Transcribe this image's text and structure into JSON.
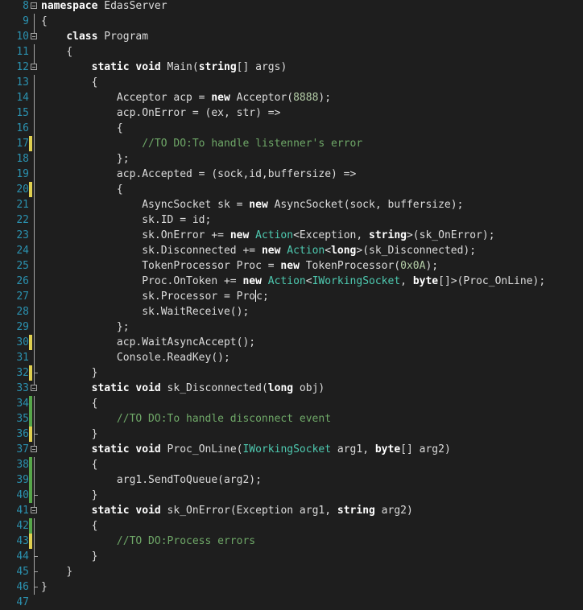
{
  "editor": {
    "colors": {
      "background": "#1e1e1e",
      "line_number": "#2b91af",
      "keyword": "#ffffff",
      "type": "#4ec9b0",
      "comment": "#6fa868",
      "number": "#b5cea8",
      "text": "#dcdcdc",
      "marker_saved": "#57a64a",
      "marker_unsaved": "#e0d050"
    },
    "lines": [
      {
        "n": "8",
        "marker": "",
        "fold": "toggle",
        "indent": "",
        "tokens": [
          {
            "t": "namespace",
            "k": "kw"
          },
          {
            "t": " EdasServer",
            "k": "plain"
          }
        ]
      },
      {
        "n": "9",
        "marker": "",
        "fold": "line",
        "indent": "",
        "tokens": [
          {
            "t": "{",
            "k": "plain"
          }
        ]
      },
      {
        "n": "10",
        "marker": "",
        "fold": "toggle",
        "indent": "    ",
        "tokens": [
          {
            "t": "class",
            "k": "kw"
          },
          {
            "t": " Program",
            "k": "plain"
          }
        ]
      },
      {
        "n": "11",
        "marker": "",
        "fold": "line",
        "indent": "    ",
        "tokens": [
          {
            "t": "{",
            "k": "plain"
          }
        ]
      },
      {
        "n": "12",
        "marker": "",
        "fold": "toggle",
        "indent": "        ",
        "tokens": [
          {
            "t": "static",
            "k": "kw"
          },
          {
            "t": " ",
            "k": "plain"
          },
          {
            "t": "void",
            "k": "kw"
          },
          {
            "t": " Main(",
            "k": "plain"
          },
          {
            "t": "string",
            "k": "kw"
          },
          {
            "t": "[] args)",
            "k": "plain"
          }
        ]
      },
      {
        "n": "13",
        "marker": "",
        "fold": "line",
        "indent": "        ",
        "tokens": [
          {
            "t": "{",
            "k": "plain"
          }
        ]
      },
      {
        "n": "14",
        "marker": "",
        "fold": "line",
        "indent": "            ",
        "tokens": [
          {
            "t": "Acceptor acp = ",
            "k": "plain"
          },
          {
            "t": "new",
            "k": "kw"
          },
          {
            "t": " Acceptor(",
            "k": "plain"
          },
          {
            "t": "8888",
            "k": "num"
          },
          {
            "t": ");",
            "k": "plain"
          }
        ]
      },
      {
        "n": "15",
        "marker": "",
        "fold": "line",
        "indent": "            ",
        "tokens": [
          {
            "t": "acp.OnError = (ex, str) =>",
            "k": "plain"
          }
        ]
      },
      {
        "n": "16",
        "marker": "",
        "fold": "line",
        "indent": "            ",
        "tokens": [
          {
            "t": "{",
            "k": "plain"
          }
        ]
      },
      {
        "n": "17",
        "marker": "yellow",
        "fold": "line",
        "indent": "                ",
        "tokens": [
          {
            "t": "//TO DO:To handle listenner's error",
            "k": "cm"
          }
        ]
      },
      {
        "n": "18",
        "marker": "",
        "fold": "line",
        "indent": "            ",
        "tokens": [
          {
            "t": "};",
            "k": "plain"
          }
        ]
      },
      {
        "n": "19",
        "marker": "",
        "fold": "line",
        "indent": "            ",
        "tokens": [
          {
            "t": "acp.Accepted = (sock,id,buffersize) =>",
            "k": "plain"
          }
        ]
      },
      {
        "n": "20",
        "marker": "yellow",
        "fold": "line",
        "indent": "            ",
        "tokens": [
          {
            "t": "{",
            "k": "plain"
          }
        ]
      },
      {
        "n": "21",
        "marker": "",
        "fold": "line",
        "indent": "                ",
        "tokens": [
          {
            "t": "AsyncSocket sk = ",
            "k": "plain"
          },
          {
            "t": "new",
            "k": "kw"
          },
          {
            "t": " AsyncSocket(sock, buffersize);",
            "k": "plain"
          }
        ]
      },
      {
        "n": "22",
        "marker": "",
        "fold": "line",
        "indent": "                ",
        "tokens": [
          {
            "t": "sk.ID = id;",
            "k": "plain"
          }
        ]
      },
      {
        "n": "23",
        "marker": "",
        "fold": "line",
        "indent": "                ",
        "tokens": [
          {
            "t": "sk.OnError += ",
            "k": "plain"
          },
          {
            "t": "new",
            "k": "kw"
          },
          {
            "t": " ",
            "k": "plain"
          },
          {
            "t": "Action",
            "k": "type"
          },
          {
            "t": "<Exception, ",
            "k": "plain"
          },
          {
            "t": "string",
            "k": "kw"
          },
          {
            "t": ">(sk_OnError);",
            "k": "plain"
          }
        ]
      },
      {
        "n": "24",
        "marker": "",
        "fold": "line",
        "indent": "                ",
        "tokens": [
          {
            "t": "sk.Disconnected += ",
            "k": "plain"
          },
          {
            "t": "new",
            "k": "kw"
          },
          {
            "t": " ",
            "k": "plain"
          },
          {
            "t": "Action",
            "k": "type"
          },
          {
            "t": "<",
            "k": "plain"
          },
          {
            "t": "long",
            "k": "kw"
          },
          {
            "t": ">(sk_Disconnected);",
            "k": "plain"
          }
        ]
      },
      {
        "n": "25",
        "marker": "",
        "fold": "line",
        "indent": "                ",
        "tokens": [
          {
            "t": "TokenProcessor Proc = ",
            "k": "plain"
          },
          {
            "t": "new",
            "k": "kw"
          },
          {
            "t": " TokenProcessor(",
            "k": "plain"
          },
          {
            "t": "0x0A",
            "k": "num"
          },
          {
            "t": ");",
            "k": "plain"
          }
        ]
      },
      {
        "n": "26",
        "marker": "",
        "fold": "line",
        "indent": "                ",
        "tokens": [
          {
            "t": "Proc.OnToken += ",
            "k": "plain"
          },
          {
            "t": "new",
            "k": "kw"
          },
          {
            "t": " ",
            "k": "plain"
          },
          {
            "t": "Action",
            "k": "type"
          },
          {
            "t": "<",
            "k": "plain"
          },
          {
            "t": "IWorkingSocket",
            "k": "type"
          },
          {
            "t": ", ",
            "k": "plain"
          },
          {
            "t": "byte",
            "k": "kw"
          },
          {
            "t": "[]>(Proc_OnLine);",
            "k": "plain"
          }
        ]
      },
      {
        "n": "27",
        "marker": "",
        "fold": "line",
        "indent": "                ",
        "tokens": [
          {
            "t": "sk.Processor = Pro",
            "k": "plain"
          },
          {
            "t": "",
            "k": "caret"
          },
          {
            "t": "c;",
            "k": "plain"
          }
        ]
      },
      {
        "n": "28",
        "marker": "",
        "fold": "line",
        "indent": "                ",
        "tokens": [
          {
            "t": "sk.WaitReceive();",
            "k": "plain"
          }
        ]
      },
      {
        "n": "29",
        "marker": "",
        "fold": "line",
        "indent": "            ",
        "tokens": [
          {
            "t": "};",
            "k": "plain"
          }
        ]
      },
      {
        "n": "30",
        "marker": "yellow",
        "fold": "line",
        "indent": "            ",
        "tokens": [
          {
            "t": "acp.WaitAsyncAccept();",
            "k": "plain"
          }
        ]
      },
      {
        "n": "31",
        "marker": "",
        "fold": "line",
        "indent": "            ",
        "tokens": [
          {
            "t": "Console.ReadKey();",
            "k": "plain"
          }
        ]
      },
      {
        "n": "32",
        "marker": "yellow",
        "fold": "end",
        "indent": "        ",
        "tokens": [
          {
            "t": "}",
            "k": "plain"
          }
        ]
      },
      {
        "n": "33",
        "marker": "",
        "fold": "toggle",
        "indent": "        ",
        "tokens": [
          {
            "t": "static",
            "k": "kw"
          },
          {
            "t": " ",
            "k": "plain"
          },
          {
            "t": "void",
            "k": "kw"
          },
          {
            "t": " sk_Disconnected(",
            "k": "plain"
          },
          {
            "t": "long",
            "k": "kw"
          },
          {
            "t": " obj)",
            "k": "plain"
          }
        ]
      },
      {
        "n": "34",
        "marker": "green",
        "fold": "line",
        "indent": "        ",
        "tokens": [
          {
            "t": "{",
            "k": "plain"
          }
        ]
      },
      {
        "n": "35",
        "marker": "green",
        "fold": "line",
        "indent": "            ",
        "tokens": [
          {
            "t": "//TO DO:To handle disconnect event",
            "k": "cm"
          }
        ]
      },
      {
        "n": "36",
        "marker": "yellow",
        "fold": "end",
        "indent": "        ",
        "tokens": [
          {
            "t": "}",
            "k": "plain"
          }
        ]
      },
      {
        "n": "37",
        "marker": "",
        "fold": "toggle",
        "indent": "        ",
        "tokens": [
          {
            "t": "static",
            "k": "kw"
          },
          {
            "t": " ",
            "k": "plain"
          },
          {
            "t": "void",
            "k": "kw"
          },
          {
            "t": " Proc_OnLine(",
            "k": "plain"
          },
          {
            "t": "IWorkingSocket",
            "k": "type"
          },
          {
            "t": " arg1, ",
            "k": "plain"
          },
          {
            "t": "byte",
            "k": "kw"
          },
          {
            "t": "[] arg2)",
            "k": "plain"
          }
        ]
      },
      {
        "n": "38",
        "marker": "green",
        "fold": "line",
        "indent": "        ",
        "tokens": [
          {
            "t": "{",
            "k": "plain"
          }
        ]
      },
      {
        "n": "39",
        "marker": "green",
        "fold": "line",
        "indent": "            ",
        "tokens": [
          {
            "t": "arg1.SendToQueue(arg2);",
            "k": "plain"
          }
        ]
      },
      {
        "n": "40",
        "marker": "green",
        "fold": "end",
        "indent": "        ",
        "tokens": [
          {
            "t": "}",
            "k": "plain"
          }
        ]
      },
      {
        "n": "41",
        "marker": "",
        "fold": "toggle",
        "indent": "        ",
        "tokens": [
          {
            "t": "static",
            "k": "kw"
          },
          {
            "t": " ",
            "k": "plain"
          },
          {
            "t": "void",
            "k": "kw"
          },
          {
            "t": " sk_OnError(Exception arg1, ",
            "k": "plain"
          },
          {
            "t": "string",
            "k": "kw"
          },
          {
            "t": " arg2)",
            "k": "plain"
          }
        ]
      },
      {
        "n": "42",
        "marker": "green",
        "fold": "line",
        "indent": "        ",
        "tokens": [
          {
            "t": "{",
            "k": "plain"
          }
        ]
      },
      {
        "n": "43",
        "marker": "yellow",
        "fold": "line",
        "indent": "            ",
        "tokens": [
          {
            "t": "//TO DO:Process errors",
            "k": "cm"
          }
        ]
      },
      {
        "n": "44",
        "marker": "",
        "fold": "end",
        "indent": "        ",
        "tokens": [
          {
            "t": "}",
            "k": "plain"
          }
        ]
      },
      {
        "n": "45",
        "marker": "",
        "fold": "end",
        "indent": "    ",
        "tokens": [
          {
            "t": "}",
            "k": "plain"
          }
        ]
      },
      {
        "n": "46",
        "marker": "",
        "fold": "end",
        "indent": "",
        "tokens": [
          {
            "t": "}",
            "k": "plain"
          }
        ]
      },
      {
        "n": "47",
        "marker": "",
        "fold": "",
        "indent": "",
        "tokens": []
      }
    ]
  }
}
